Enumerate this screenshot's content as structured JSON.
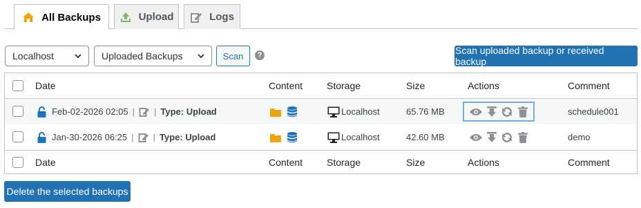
{
  "tabs": [
    {
      "label": "All Backups",
      "icon": "home-icon",
      "active": true
    },
    {
      "label": "Upload",
      "icon": "upload-icon",
      "active": false
    },
    {
      "label": "Logs",
      "icon": "edit-icon",
      "active": false
    }
  ],
  "controls": {
    "location_select": "Localhost",
    "backup_type_select": "Uploaded Backups",
    "scan_label": "Scan",
    "help_glyph": "?",
    "scan_uploaded_label": "Scan uploaded backup or received backup"
  },
  "table": {
    "columns": [
      "Date",
      "Content",
      "Storage",
      "Size",
      "Actions",
      "Comment"
    ],
    "rows": [
      {
        "date": "Feb-02-2026 02:05",
        "type": "Type: Upload",
        "storage": "Localhost",
        "size": "65.76 MB",
        "comment": "schedule001"
      },
      {
        "date": "Jan-30-2026 06:25",
        "type": "Type: Upload",
        "storage": "Localhost",
        "size": "42.60 MB",
        "comment": "demo"
      }
    ]
  },
  "delete_label": "Delete the selected backups",
  "colors": {
    "accent": "#2271b1",
    "folder": "#f0a30a",
    "database": "#1e73be",
    "lock": "#1e73be",
    "action_icon": "#8c8f94",
    "home_icon": "#f0a30a",
    "upload_icon": "#7ab85f"
  }
}
